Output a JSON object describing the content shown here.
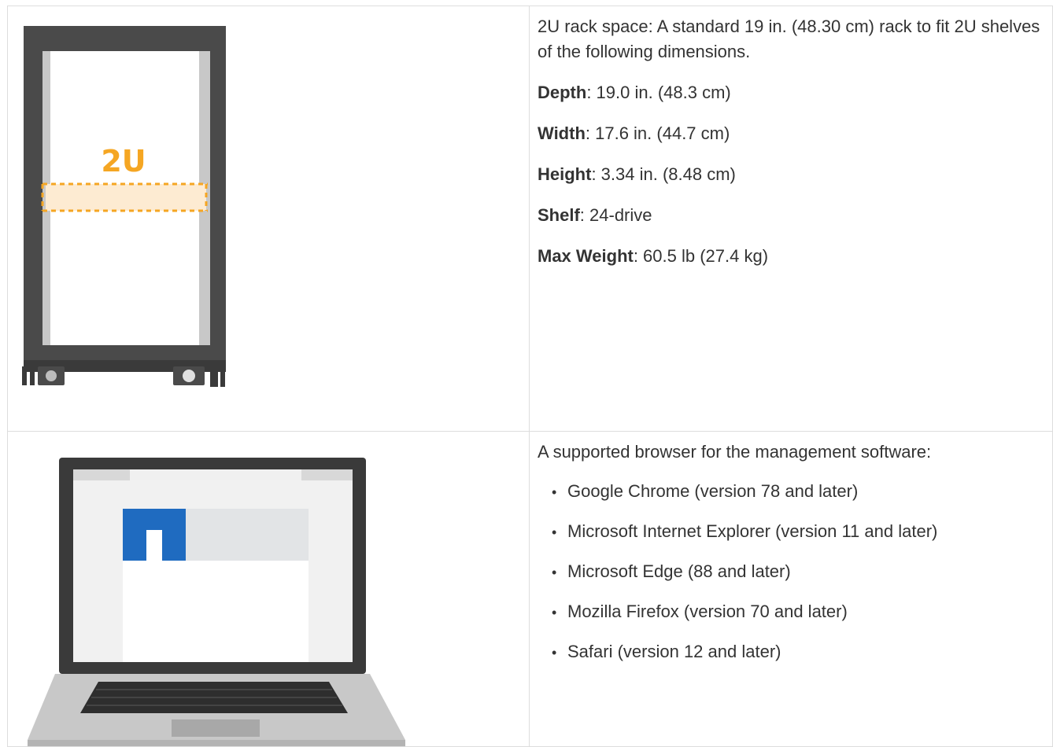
{
  "rack": {
    "label": "2U",
    "intro": "2U rack space: A standard 19 in. (48.30 cm) rack to fit 2U shelves of the following dimensions.",
    "specs": [
      {
        "key": "Depth",
        "value": ": 19.0 in. (48.3 cm)"
      },
      {
        "key": "Width",
        "value": ": 17.6 in. (44.7 cm)"
      },
      {
        "key": "Height",
        "value": ": 3.34 in. (8.48 cm)"
      },
      {
        "key": "Shelf",
        "value": ": 24-drive"
      },
      {
        "key": "Max Weight",
        "value": ": 60.5 lb (27.4 kg)"
      }
    ]
  },
  "browser": {
    "intro": "A supported browser for the management software:",
    "items": [
      "Google Chrome (version 78 and later)",
      "Microsoft Internet Explorer (version 11 and later)",
      "Microsoft Edge (88 and later)",
      "Mozilla Firefox (version 70 and later)",
      "Safari (version 12 and later)"
    ]
  },
  "colors": {
    "rack_frame": "#4a4a4a",
    "accent_orange": "#f5a623",
    "logo_blue": "#1f6bc0",
    "border": "#dddddd"
  },
  "icons": [
    "rack-illustration",
    "laptop-illustration",
    "logo-icon"
  ]
}
